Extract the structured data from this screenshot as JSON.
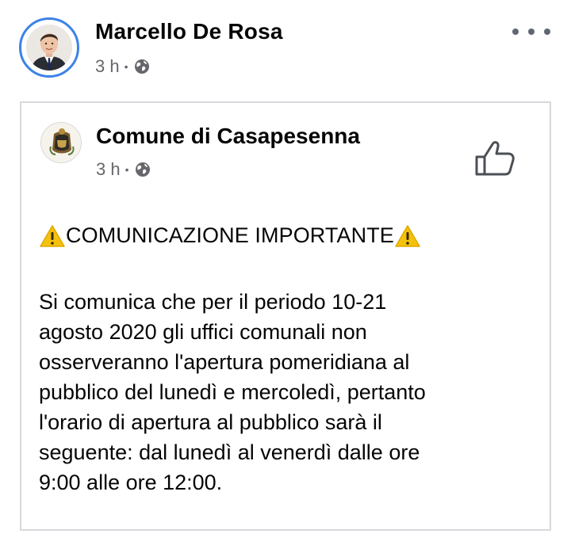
{
  "post": {
    "author_name": "Marcello De Rosa",
    "time": "3 h",
    "separator": "•",
    "privacy_icon": "globe-icon",
    "more_icon": "more-options-icon"
  },
  "shared": {
    "page_name": "Comune di Casapesenna",
    "time": "3 h",
    "separator": "•",
    "privacy_icon": "globe-icon",
    "like_icon": "thumbs-up-icon",
    "headline": "COMUNICAZIONE IMPORTANTE",
    "headline_icon": "warning-sign-icon",
    "body": "Si comunica che per il periodo 10-21\nagosto 2020 gli uffici comunali non\nosserveranno l'apertura pomeridiana al\npubblico del lunedì e mercoledì, pertanto\nl'orario di apertura al pubblico sarà il\nseguente: dal lunedì al venerdì dalle ore\n9:00 alle ore 12:00."
  },
  "colors": {
    "avatar_ring": "#3b82e8",
    "meta_text": "#65676b",
    "card_border": "#d7d9dd",
    "warning_yellow": "#f4c20d"
  }
}
